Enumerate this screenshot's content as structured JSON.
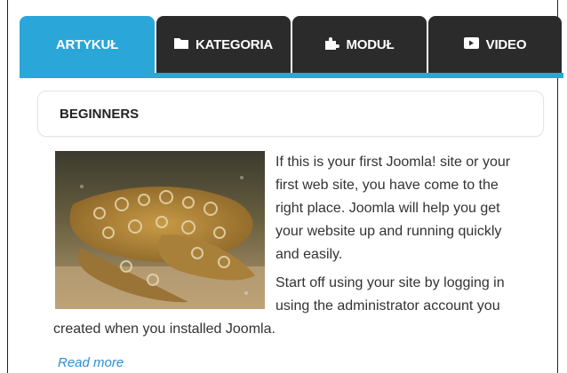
{
  "tabs": [
    {
      "label": "ARTYKUŁ",
      "icon": "",
      "active": true
    },
    {
      "label": "KATEGORIA",
      "icon": "folder-icon",
      "active": false
    },
    {
      "label": "MODUŁ",
      "icon": "puzzle-icon",
      "active": false
    },
    {
      "label": "VIDEO",
      "icon": "video-icon",
      "active": false
    }
  ],
  "colors": {
    "accent": "#2ba6d8",
    "tab_dark": "#2b2b2b",
    "link": "#2a8fd1"
  },
  "article": {
    "heading": "BEGINNERS",
    "image_icon": "shark-photo",
    "paragraph1": "If this is your first Joomla! site or your first web site, you have come to the right place. Joomla will help you get your website up and running quickly and easily.",
    "paragraph2": "Start off using your site by logging in using the administrator account you created when you installed Joomla.",
    "read_more": "Read more"
  }
}
